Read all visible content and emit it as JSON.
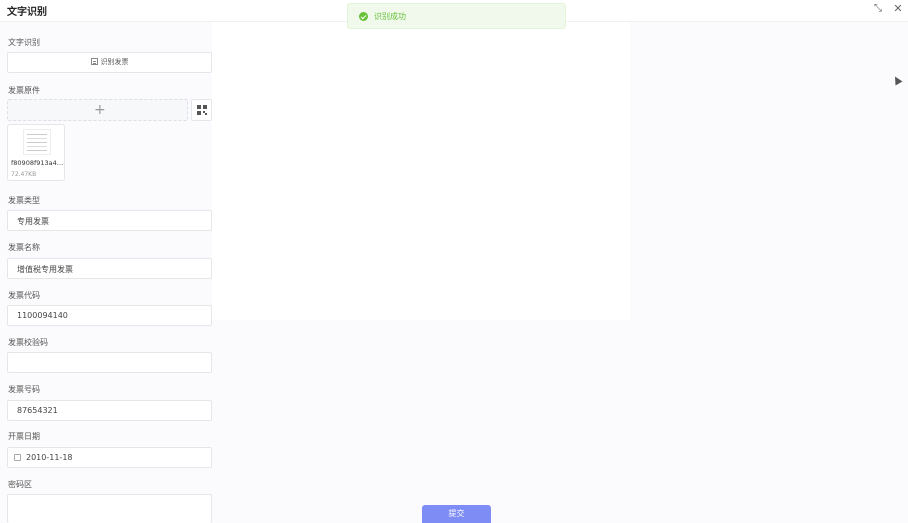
{
  "window": {
    "title": "文字识别",
    "collapse_glyph": "⤡",
    "close_glyph": "✕"
  },
  "toast": {
    "message": "识别成功",
    "icon": "check-circle-icon",
    "color": "#67c23a"
  },
  "form": {
    "ocr": {
      "label": "文字识别",
      "button_label": "识别发票"
    },
    "attachment": {
      "label": "发票原件",
      "file_name": "f80908f913a4…",
      "file_size": "72.47KB"
    },
    "invoice_type": {
      "label": "发票类型",
      "value": "专用发票"
    },
    "invoice_name": {
      "label": "发票名称",
      "value": "增值税专用发票"
    },
    "invoice_code": {
      "label": "发票代码",
      "value": "1100094140"
    },
    "check_code": {
      "label": "发票校验码",
      "value": ""
    },
    "invoice_number": {
      "label": "发票号码",
      "value": "87654321"
    },
    "issue_date": {
      "label": "开票日期",
      "value": "2010-11-18"
    },
    "password_area": {
      "label": "密码区"
    }
  },
  "footer": {
    "submit_label": "提交"
  },
  "colors": {
    "accent": "#7e8cf5",
    "success": "#67c23a"
  }
}
